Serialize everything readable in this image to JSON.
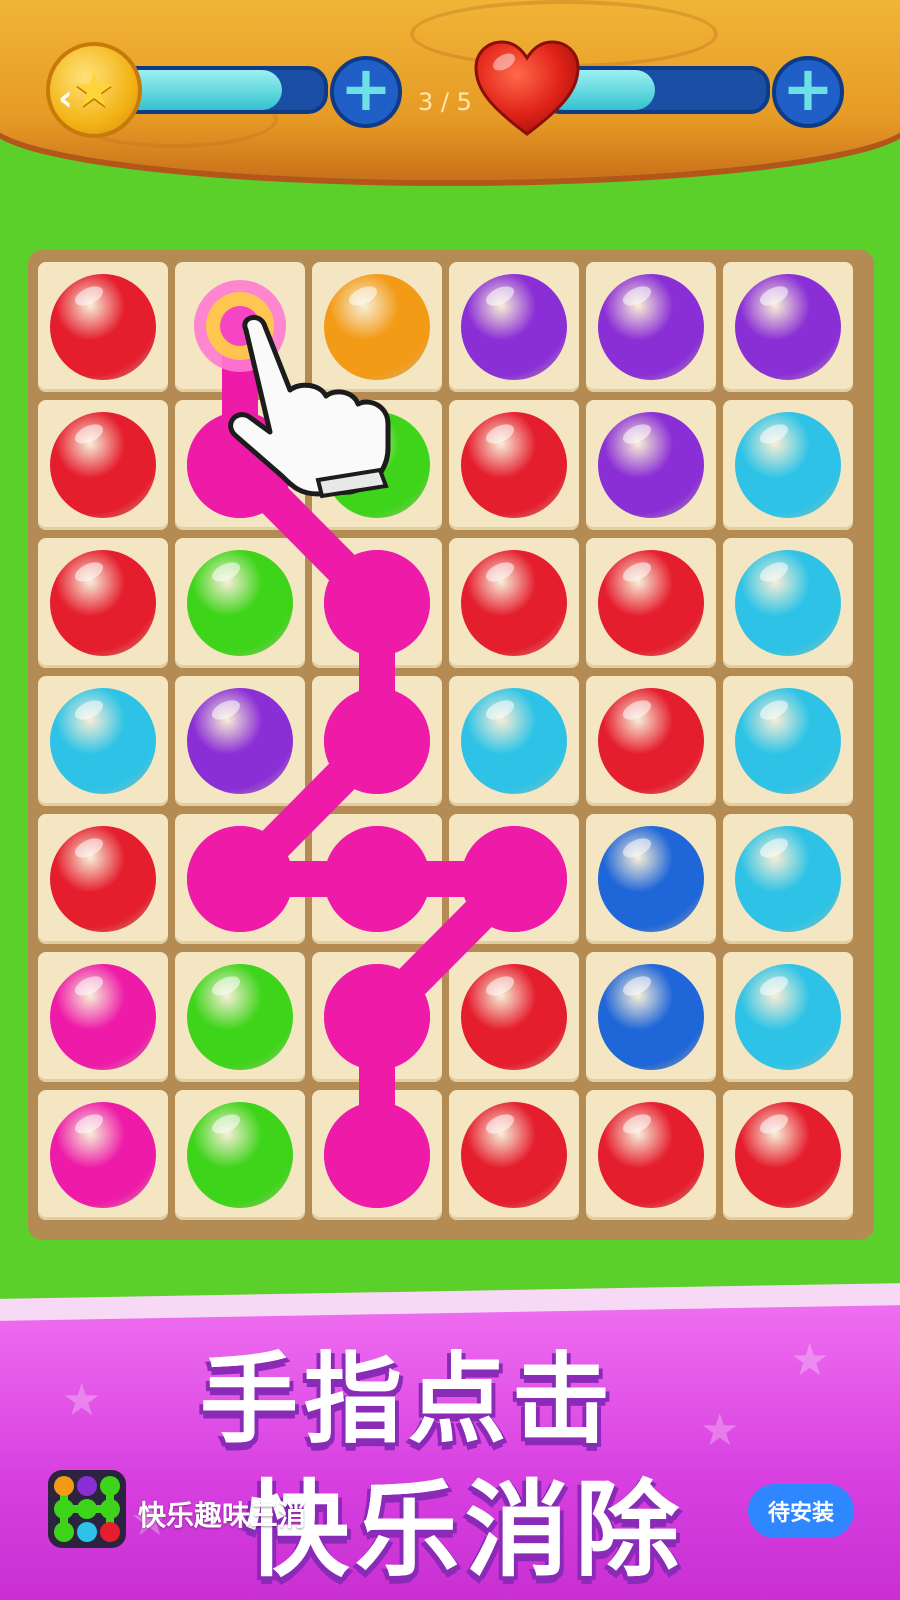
{
  "header": {
    "back_icon": "chevron-left-icon",
    "coin_icon": "star-coin-icon",
    "coin_progress": 0.8,
    "level_counter": "3 / 5",
    "heart_icon": "heart-icon",
    "lives_progress": 0.5,
    "plus_icon": "plus-icon"
  },
  "board": {
    "rows": 7,
    "cols": 6,
    "colors": {
      "red": "#e51e2e",
      "orange": "#f39a16",
      "purple": "#8a2fd6",
      "green": "#3ed41a",
      "cyan": "#2ec3e6",
      "blue": "#1f66d8",
      "pink": "#ee1aa8"
    },
    "grid": [
      [
        "red",
        "none",
        "orange",
        "purple",
        "purple",
        "purple"
      ],
      [
        "red",
        "pink",
        "green",
        "red",
        "purple",
        "cyan"
      ],
      [
        "red",
        "green",
        "pink",
        "red",
        "red",
        "cyan"
      ],
      [
        "cyan",
        "purple",
        "pink",
        "cyan",
        "red",
        "cyan"
      ],
      [
        "red",
        "pink",
        "pink",
        "pink",
        "blue",
        "cyan"
      ],
      [
        "pink",
        "green",
        "pink",
        "red",
        "blue",
        "cyan"
      ],
      [
        "pink",
        "green",
        "pink",
        "red",
        "red",
        "red"
      ]
    ],
    "connection_path": [
      [
        0,
        1
      ],
      [
        1,
        1
      ],
      [
        2,
        2
      ],
      [
        3,
        2
      ],
      [
        4,
        1
      ],
      [
        4,
        2
      ],
      [
        4,
        3
      ],
      [
        5,
        2
      ],
      [
        6,
        2
      ]
    ],
    "path_color": "#ee1aa8",
    "tutorial_hand_icon": "pointing-hand-icon"
  },
  "promo": {
    "line1": "手指点击",
    "line2": "快乐消除",
    "app_name": "快乐趣味三消",
    "install_label": "待安装",
    "app_icon": "app-icon"
  }
}
